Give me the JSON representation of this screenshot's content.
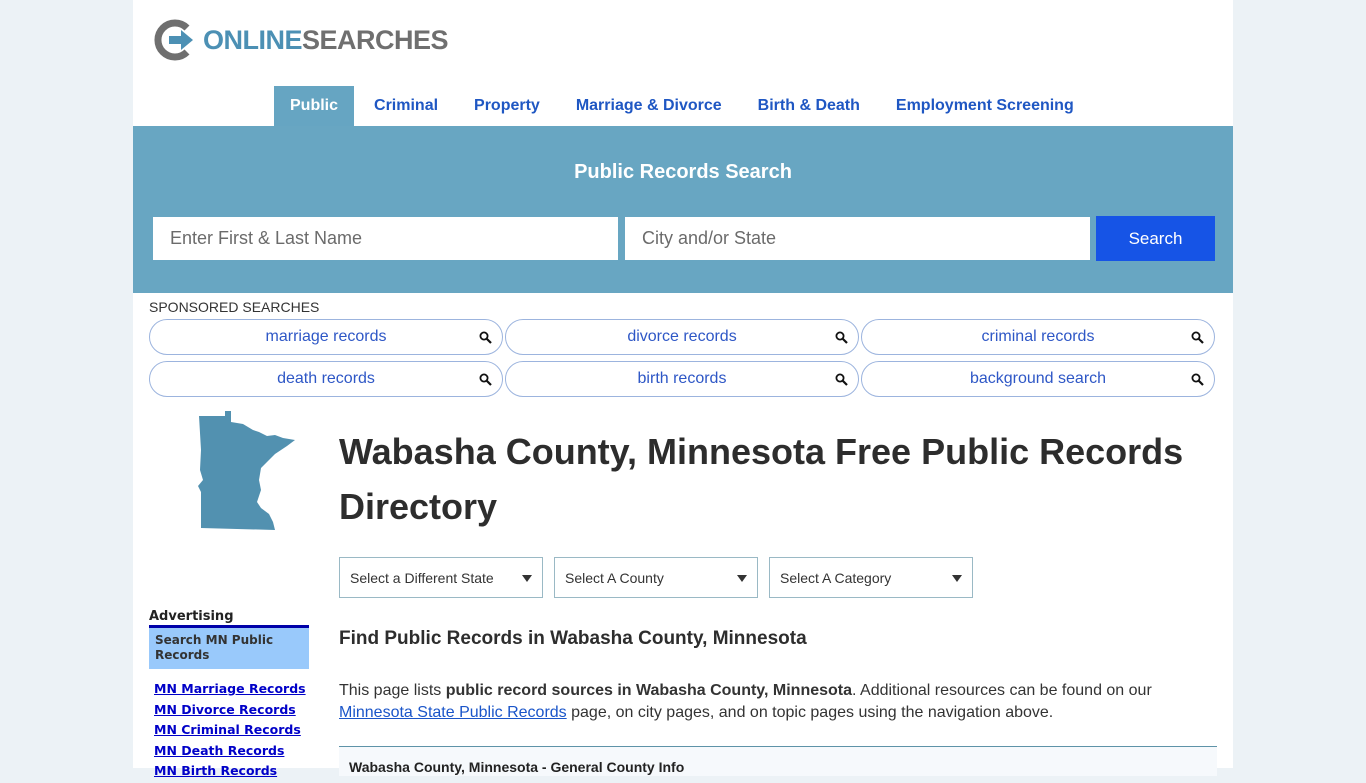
{
  "logo": {
    "word1": "ONLINE",
    "word2": "SEARCHES",
    "colors": {
      "primary": "#4c90b4",
      "secondary": "#6f6f6f"
    }
  },
  "nav": {
    "items": [
      {
        "label": "Public",
        "active": true
      },
      {
        "label": "Criminal"
      },
      {
        "label": "Property"
      },
      {
        "label": "Marriage & Divorce"
      },
      {
        "label": "Birth & Death"
      },
      {
        "label": "Employment Screening"
      }
    ]
  },
  "search": {
    "title": "Public Records Search",
    "name_placeholder": "Enter First & Last Name",
    "name_value": "",
    "city_placeholder": "City and/or State",
    "city_value": "",
    "button_label": "Search",
    "button_color": "#1654e6",
    "band_color": "#68a6c2"
  },
  "sponsored": {
    "label": "SPONSORED SEARCHES",
    "items": [
      {
        "label": "marriage records",
        "icon": "search-icon"
      },
      {
        "label": "divorce records",
        "icon": "search-icon"
      },
      {
        "label": "criminal records",
        "icon": "search-icon"
      },
      {
        "label": "death records",
        "icon": "search-icon"
      },
      {
        "label": "birth records",
        "icon": "search-icon"
      },
      {
        "label": "background search",
        "icon": "search-icon"
      }
    ]
  },
  "sidebar": {
    "map_icon": "minnesota-map-icon",
    "ad_label": "Advertising",
    "ad_box": "Search MN Public Records",
    "links": [
      "MN Marriage Records",
      "MN Divorce Records",
      "MN Criminal Records",
      "MN Death Records",
      "MN Birth Records"
    ]
  },
  "main": {
    "title": "Wabasha County, Minnesota Free Public Records Directory",
    "selects": [
      {
        "selected": "Select a Different State"
      },
      {
        "selected": "Select A County"
      },
      {
        "selected": "Select A Category"
      }
    ],
    "subtitle": "Find Public Records in Wabasha County, Minnesota",
    "para": {
      "p1": "This page lists ",
      "bold": "public record sources in Wabasha County, Minnesota",
      "p2": ". Additional resources can be found on our ",
      "link": "Minnesota State Public Records",
      "p3": " page, on city pages, and on topic pages using the navigation above."
    },
    "info_header": "Wabasha County, Minnesota - General County Info"
  }
}
